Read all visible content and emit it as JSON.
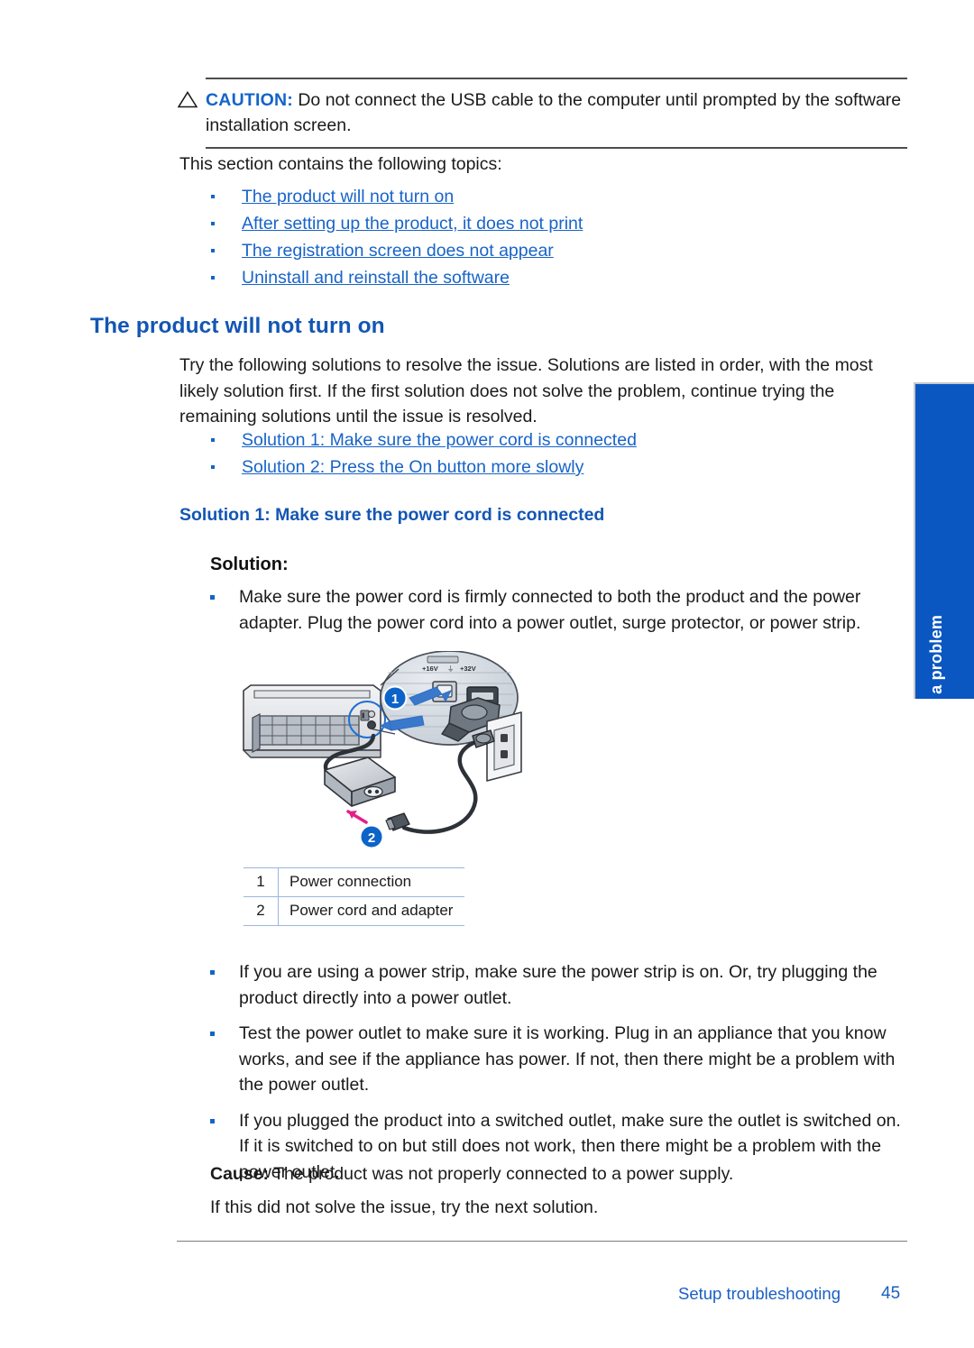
{
  "caution": {
    "icon": "warning-triangle-icon",
    "label": "CAUTION:",
    "text": "Do not connect the USB cable to the computer until prompted by the software installation screen."
  },
  "intro": {
    "line": "This section contains the following topics:"
  },
  "toc_links": [
    {
      "label": "The product will not turn on"
    },
    {
      "label": "After setting up the product, it does not print"
    },
    {
      "label": "The registration screen does not appear"
    },
    {
      "label": "Uninstall and reinstall the software"
    }
  ],
  "section": {
    "heading": "The product will not turn on",
    "intro_paragraph": "Try the following solutions to resolve the issue. Solutions are listed in order, with the most likely solution first. If the first solution does not solve the problem, continue trying the remaining solutions until the issue is resolved."
  },
  "solution_links": [
    {
      "label": "Solution 1: Make sure the power cord is connected"
    },
    {
      "label": "Solution 2: Press the On button more slowly"
    }
  ],
  "solution1": {
    "heading": "Solution 1: Make sure the power cord is connected",
    "solution_label": "Solution:",
    "bullets": [
      "Make sure the power cord is firmly connected to both the product and the power adapter. Plug the power cord into a power outlet, surge protector, or power strip."
    ]
  },
  "figure": {
    "name": "printer-power-connection-diagram",
    "callout_badges": [
      "1",
      "2"
    ],
    "port_labels": "+16V +32V",
    "legend": {
      "rows": [
        {
          "num": "1",
          "label": "Power connection"
        },
        {
          "num": "2",
          "label": "Power cord and adapter"
        }
      ]
    }
  },
  "extra_bullets": [
    "If you are using a power strip, make sure the power strip is on. Or, try plugging the product directly into a power outlet.",
    "Test the power outlet to make sure it is working. Plug in an appliance that you know works, and see if the appliance has power. If not, then there might be a problem with the power outlet.",
    "If you plugged the product into a switched outlet, make sure the outlet is switched on. If it is switched to on but still does not work, then there might be a problem with the power outlet."
  ],
  "cause": {
    "label": "Cause:",
    "text": "The product was not properly connected to a power supply."
  },
  "closing": "If this did not solve the issue, try the next solution.",
  "side_tab": {
    "label": "Solve a problem",
    "color": "#0a57c2"
  },
  "footer": {
    "title": "Setup troubleshooting",
    "page": "45"
  },
  "colors": {
    "link": "#1864c8",
    "heading": "#1356b4",
    "caution": "#1464c8",
    "tab": "#0a57c2",
    "footer": "#1a5fc4"
  }
}
